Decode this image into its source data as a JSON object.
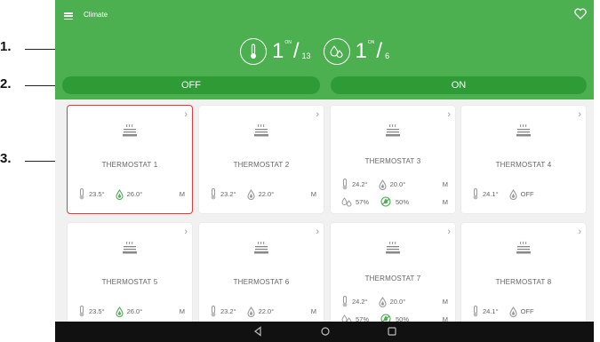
{
  "callouts": [
    "1.",
    "2.",
    "3."
  ],
  "app": {
    "title": "Climate",
    "menu_icon": "hamburger-menu-icon",
    "favorite_icon": "heart-outline-icon",
    "colors": {
      "header": "#4caf50",
      "toggle": "#2e9b37",
      "highlight": "#e53935",
      "active_drop": "#4caf50"
    }
  },
  "stats": {
    "heating": {
      "icon": "thermometer-icon",
      "on": "1",
      "on_label": "ON",
      "total": "13"
    },
    "humidity": {
      "icon": "humidity-drops-icon",
      "on": "1",
      "on_label": "ON",
      "total": "6"
    }
  },
  "toggles": {
    "off_label": "OFF",
    "on_label": "ON"
  },
  "cards": [
    {
      "name": "THERMOSTAT 1",
      "temp": "23.5°",
      "setpoint": "26.0°",
      "mode": "M",
      "active": true
    },
    {
      "name": "THERMOSTAT 2",
      "temp": "23.2°",
      "setpoint": "22.0°",
      "mode": "M",
      "active": false
    },
    {
      "name": "THERMOSTAT 3",
      "temp": "24.2°",
      "setpoint": "20.0°",
      "mode": "M",
      "humidity": "57%",
      "hum_setpoint": "50%",
      "hum_mode": "M"
    },
    {
      "name": "THERMOSTAT 4",
      "temp": "24.1°",
      "setpoint": "OFF",
      "mode": "",
      "active": false
    },
    {
      "name": "THERMOSTAT 5",
      "temp": "23.5°",
      "setpoint": "26.0°",
      "mode": "M",
      "active": true
    },
    {
      "name": "THERMOSTAT 6",
      "temp": "23.2°",
      "setpoint": "22.0°",
      "mode": "M",
      "active": false
    },
    {
      "name": "THERMOSTAT 7",
      "temp": "24.2°",
      "setpoint": "20.0°",
      "mode": "M",
      "humidity": "57%",
      "hum_setpoint": "50%",
      "hum_mode": "M"
    },
    {
      "name": "THERMOSTAT 8",
      "temp": "24.1°",
      "setpoint": "OFF",
      "mode": "",
      "active": false
    }
  ],
  "navbar": {
    "back_icon": "back-triangle-icon",
    "home_icon": "home-circle-icon",
    "recents_icon": "recents-square-icon"
  }
}
